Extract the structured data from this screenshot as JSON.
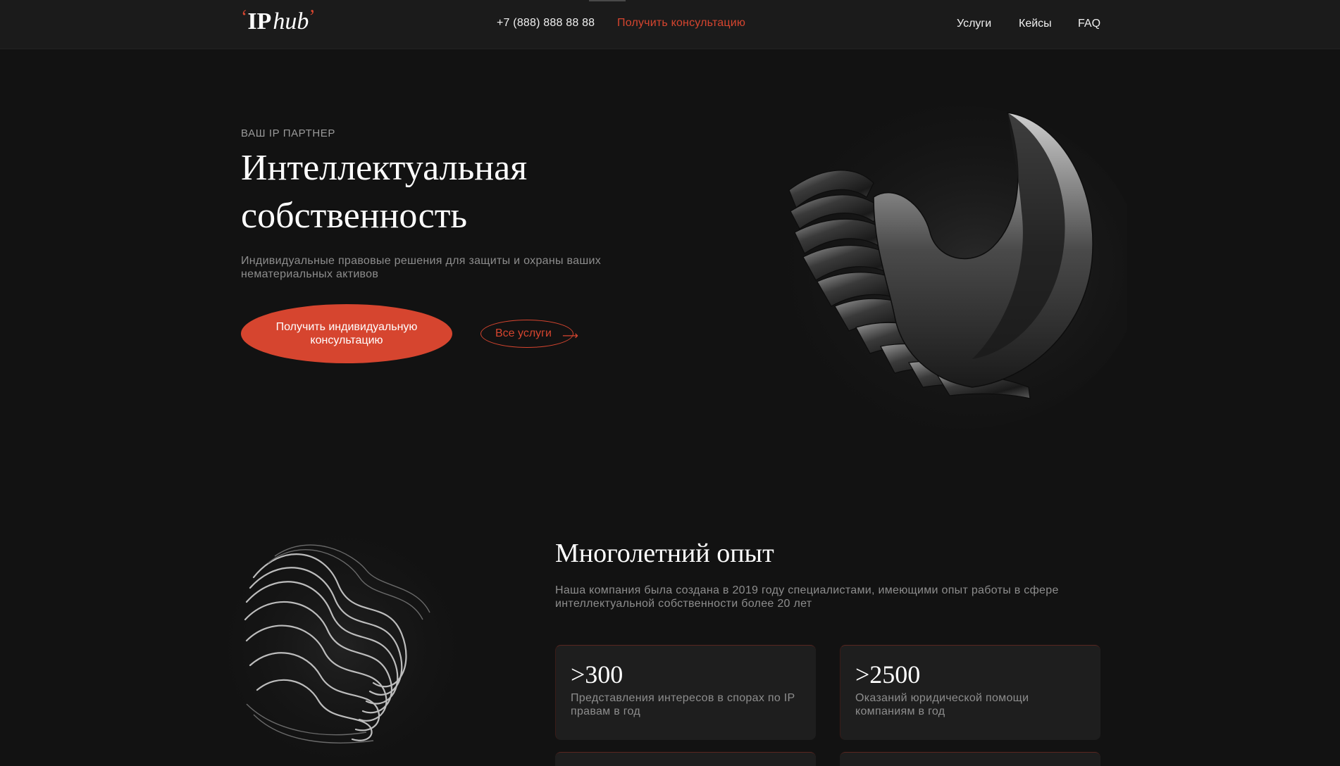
{
  "header": {
    "logo": {
      "quote_open": "‘",
      "ip": "IP",
      "hub": "hub",
      "quote_close": "’"
    },
    "phone": "+7 (888) 888 88 88",
    "consult_link": "Получить консультацию",
    "nav": [
      "Услуги",
      "Кейсы",
      "FAQ"
    ]
  },
  "hero": {
    "eyebrow": "ВАШ IP ПАРТНЕР",
    "title_line1": "Интеллектуальная",
    "title_line2": "собственность",
    "subtitle": "Индивидуальные правовые решения для защиты и охраны ваших нематериальных активов",
    "cta_label": "Получить индивидуальную консультацию",
    "services_label": "Все услуги",
    "services_arrow": "⟶"
  },
  "experience": {
    "title": "Многолетний опыт",
    "subtitle": "Наша компания была создана в 2019 году специалистами, имеющими опыт работы в сфере интеллектуальной собственности более 20 лет",
    "stats": [
      {
        "value": ">300",
        "label": "Представления интересов в спорах по IP правам в год"
      },
      {
        "value": ">2500",
        "label": "Оказаний юридической помощи компаниям в год"
      }
    ]
  },
  "colors": {
    "accent": "#d6452f",
    "background": "#121212",
    "header_bg": "#1b1b1b",
    "card_bg": "#1e1e1e",
    "muted_text": "#8d8d8d"
  }
}
